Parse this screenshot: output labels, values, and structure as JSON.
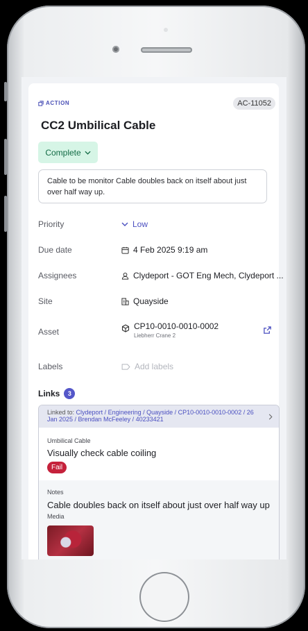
{
  "action": {
    "kind_label": "ACTION",
    "reference": "AC-11052",
    "title": "CC2 Umbilical Cable",
    "status": "Complete",
    "description": "Cable to be monitor Cable doubles back on itself about just over half way up."
  },
  "fields": {
    "priority": {
      "label": "Priority",
      "value": "Low"
    },
    "due_date": {
      "label": "Due date",
      "value": "4 Feb 2025 9:19 am"
    },
    "assignees": {
      "label": "Assignees",
      "value": "Clydeport - GOT Eng Mech, Clydeport ..."
    },
    "site": {
      "label": "Site",
      "value": "Quayside"
    },
    "asset": {
      "label": "Asset",
      "value": "CP10-0010-0010-0002",
      "subtitle": "Liebherr Crane 2"
    },
    "labels": {
      "label": "Labels",
      "placeholder": "Add labels"
    }
  },
  "links": {
    "heading": "Links",
    "count": "3",
    "linked_prefix": "Linked to:",
    "linked_path": "Clydeport / Engineering / Quayside / CP10-0010-0010-0002 / 26 Jan 2025 / Brendan McFeeley / 40233421",
    "item": {
      "category": "Umbilical Cable",
      "question": "Visually check cable coiling",
      "result": "Fail"
    },
    "notes": {
      "label": "Notes",
      "text": "Cable doubles back on itself about just over half way up",
      "media_label": "Media"
    }
  },
  "colors": {
    "accent": "#4a4fc0",
    "status_bg": "#d6f5e6",
    "status_text": "#126b45",
    "fail": "#c5213b"
  }
}
